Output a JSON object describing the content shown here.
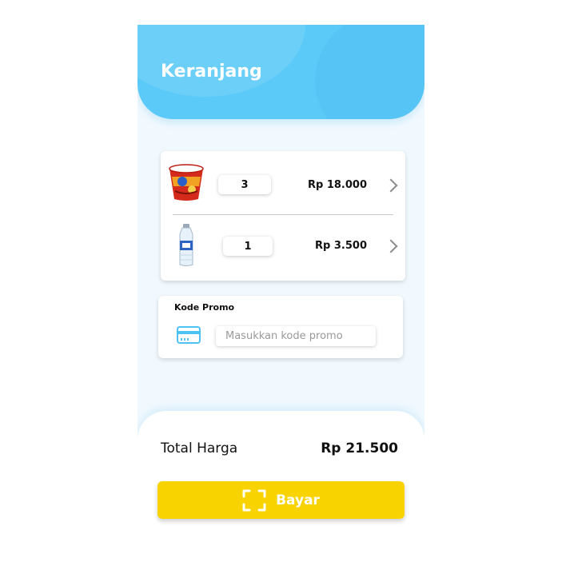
{
  "header": {
    "title": "Keranjang"
  },
  "cart": {
    "items": [
      {
        "icon": "instant-noodle-cup",
        "quantity": "3",
        "price": "Rp 18.000"
      },
      {
        "icon": "water-bottle",
        "quantity": "1",
        "price": "Rp 3.500"
      }
    ]
  },
  "promo": {
    "label": "Kode Promo",
    "placeholder": "Masukkan kode promo",
    "value": "",
    "icon": "credit-card-icon"
  },
  "summary": {
    "total_label": "Total Harga",
    "total_value": "Rp 21.500"
  },
  "pay_button": {
    "label": "Bayar",
    "icon": "scan-icon"
  },
  "colors": {
    "header": "#5ccaf8",
    "accent": "#f8d300",
    "background": "#f1f9fe",
    "icon": "#4cc3f3"
  }
}
